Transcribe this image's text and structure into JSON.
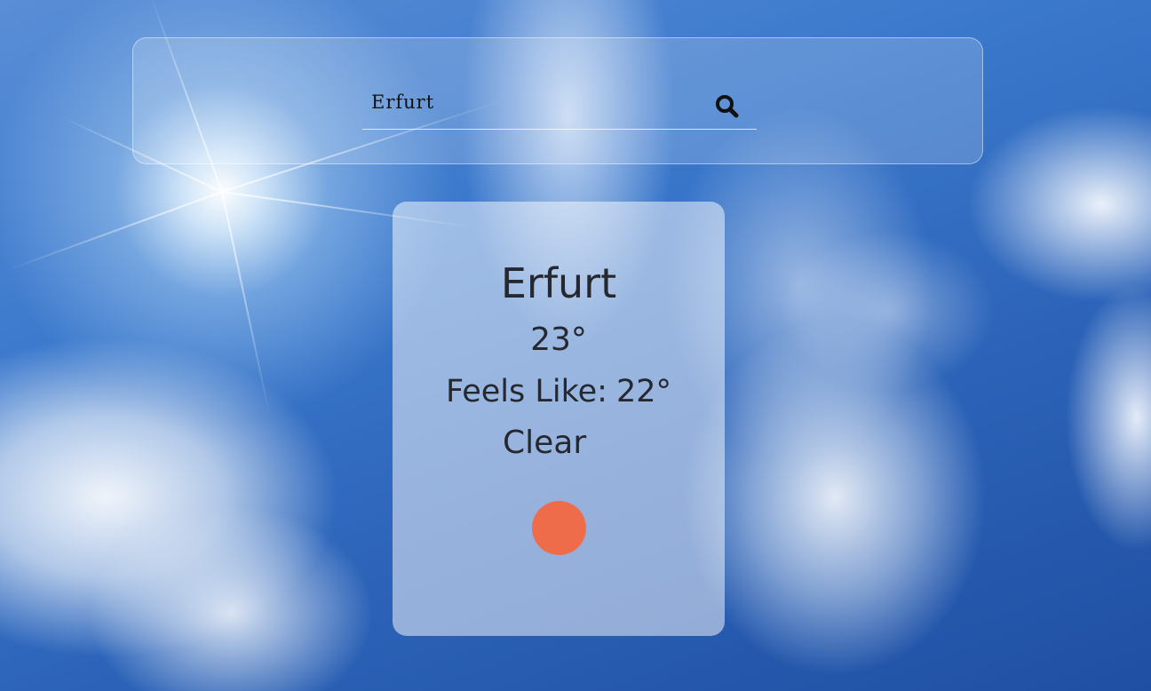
{
  "search": {
    "value": "Erfurt",
    "icon": "search-icon"
  },
  "weather": {
    "city": "Erfurt",
    "temperature": "23°",
    "feels_like_label": "Feels Like:",
    "feels_like_value": "22°",
    "condition": "Clear",
    "indicator_icon": "sun-dot-icon"
  },
  "colors": {
    "indicator": "#ef6c4b",
    "text": "#262830"
  }
}
